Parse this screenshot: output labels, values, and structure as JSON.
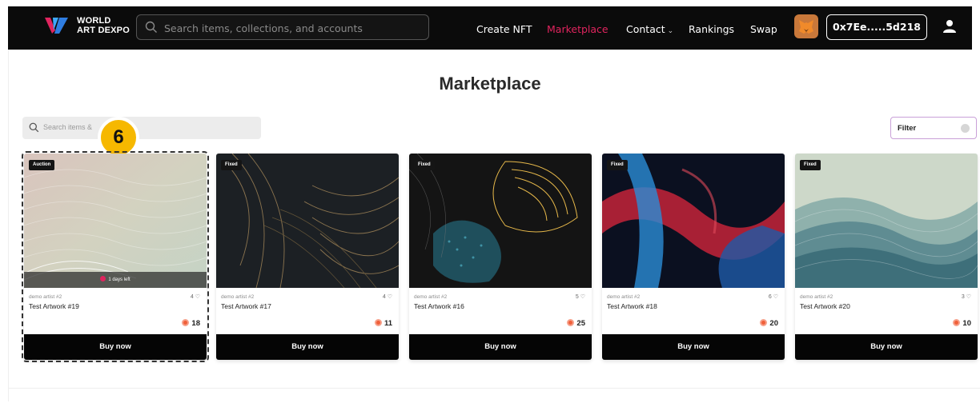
{
  "navbar": {
    "brand_line1": "WORLD",
    "brand_line2": "ART DEXPO",
    "search_placeholder": "Search items, collections, and accounts",
    "links": [
      {
        "label": "Create NFT",
        "active": false
      },
      {
        "label": "Marketplace",
        "active": true
      },
      {
        "label": "Contact",
        "active": false,
        "has_dropdown": true
      },
      {
        "label": "Rankings",
        "active": false
      },
      {
        "label": "Swap",
        "active": false
      }
    ],
    "wallet_address": "0x7Ee.....5d218",
    "icons": {
      "search": "search-icon",
      "wallet": "metamask-fox-icon",
      "user": "user-icon"
    },
    "accent_color": "#e0245e"
  },
  "page": {
    "title": "Marketplace",
    "search_placeholder": "Search items &",
    "step_badge": "6",
    "filter_label": "Filter"
  },
  "cards": [
    {
      "sale_type": "Auction",
      "time_left": "1 days left",
      "artist": "demo artist #2",
      "likes": "4",
      "name": "Test Artwork #19",
      "price": "18",
      "button": "Buy now",
      "highlighted": true
    },
    {
      "sale_type": "Fixed",
      "artist": "demo artist #2",
      "likes": "4",
      "name": "Test Artwork #17",
      "price": "11",
      "button": "Buy now"
    },
    {
      "sale_type": "Fixed",
      "artist": "demo artist #2",
      "likes": "5",
      "name": "Test Artwork #16",
      "price": "25",
      "button": "Buy now"
    },
    {
      "sale_type": "Fixed",
      "artist": "demo artist #2",
      "likes": "6",
      "name": "Test Artwork #18",
      "price": "20",
      "button": "Buy now"
    },
    {
      "sale_type": "Fixed",
      "artist": "demo artist #2",
      "likes": "3",
      "name": "Test Artwork #20",
      "price": "10",
      "button": "Buy now"
    }
  ]
}
